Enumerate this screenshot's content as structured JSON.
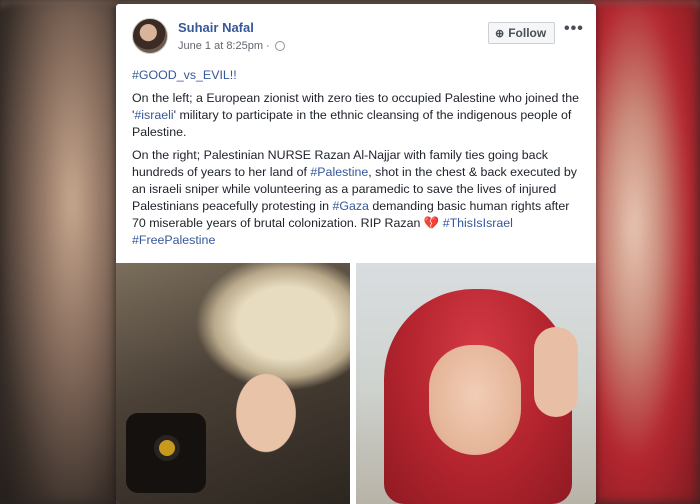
{
  "post": {
    "author": "Suhair Nafal",
    "timestamp": "June 1 at 8:25pm",
    "separator": "·",
    "follow_label": "Follow",
    "more_label": "•••",
    "hashtag_line": "#GOOD_vs_EVIL!!",
    "para1": {
      "pre": "On the left; a European zionist with zero ties to occupied Palestine who joined the '",
      "tag": "#israeli",
      "post": "' military to participate in the ethnic cleansing of the indigenous people of Palestine."
    },
    "para2": {
      "pre": "On the right; Palestinian NURSE Razan Al-Najjar with family ties going back hundreds of years to her land of ",
      "tag1": "#Palestine",
      "mid": ", shot in the chest & back executed by an israeli sniper while volunteering as a paramedic to save the lives of injured Palestinians peacefully protesting in ",
      "tag2": "#Gaza",
      "post": " demanding basic human rights after 70 miserable years of brutal colonization. RIP Razan ",
      "heart": "💔",
      "tag3": "#ThisIsIsrael",
      "tag4": "#FreePalestine"
    }
  },
  "icons": {
    "globe": "globe-icon",
    "follow": "rss-icon",
    "more": "more-icon"
  },
  "colors": {
    "link": "#365899",
    "text": "#1d2129",
    "meta": "#616770",
    "hijab": "#b3242e"
  }
}
